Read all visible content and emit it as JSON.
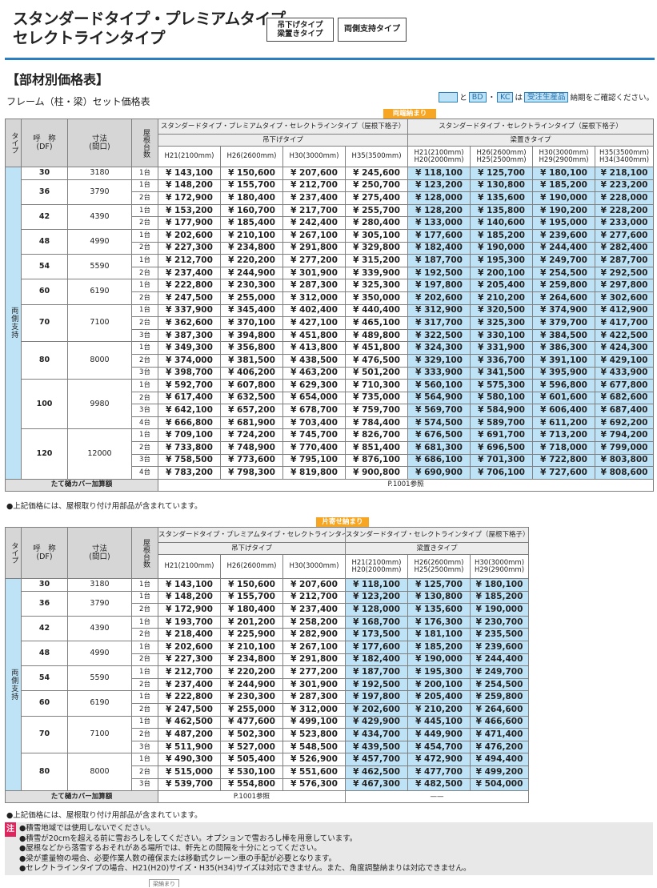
{
  "header": {
    "title_line1": "スタンダードタイプ・プレミアムタイプ",
    "title_line2": "セレクトラインタイプ",
    "tag1_line1": "吊下げタイプ",
    "tag1_line2": "梁置きタイプ",
    "tag2": "両側支持タイプ"
  },
  "section_title": "【部材別価格表】",
  "subtitle": "フレーム（柱・梁）セット価格表",
  "note_top": {
    "and": "と",
    "bd": "BD",
    "dot": "・",
    "kc": "KC",
    "on": "は",
    "order": "受注生産品",
    "suffix": "納期をご確認ください。"
  },
  "table1": {
    "badge": "両端納まり",
    "col_type": "タイプ",
    "col_name_l1": "呼　称",
    "col_name_l2": "(DF)",
    "col_size_l1": "寸法",
    "col_size_l2": "(間口)",
    "col_count": "屋根台数",
    "group_left": "スタンダードタイプ・プレミアムタイプ・セレクトラインタイプ（屋根下格子）",
    "group_right": "スタンダードタイプ・セレクトラインタイプ（屋根下格子）",
    "sub_left": "吊下げタイプ",
    "sub_right": "梁置きタイプ",
    "heights": [
      "H21(2100mm)",
      "H26(2600mm)",
      "H30(3000mm)",
      "H35(3500mm)"
    ],
    "heights2": [
      [
        "H21(2100mm)",
        "H20(2000mm)"
      ],
      [
        "H26(2600mm)",
        "H25(2500mm)"
      ],
      [
        "H30(3000mm)",
        "H29(2900mm)"
      ],
      [
        "H35(3500mm)",
        "H34(3400mm)"
      ]
    ],
    "type_label": "両側支持",
    "groups": [
      {
        "name": "30",
        "size": "3180",
        "rows": [
          [
            "1台",
            "¥ 143,100",
            "¥ 150,600",
            "¥ 207,600",
            "¥ 245,600",
            "¥ 118,100",
            "¥ 125,700",
            "¥ 180,100",
            "¥ 218,100"
          ]
        ]
      },
      {
        "name": "36",
        "size": "3790",
        "rows": [
          [
            "1台",
            "¥ 148,200",
            "¥ 155,700",
            "¥ 212,700",
            "¥ 250,700",
            "¥ 123,200",
            "¥ 130,800",
            "¥ 185,200",
            "¥ 223,200"
          ],
          [
            "2台",
            "¥ 172,900",
            "¥ 180,400",
            "¥ 237,400",
            "¥ 275,400",
            "¥ 128,000",
            "¥ 135,600",
            "¥ 190,000",
            "¥ 228,000"
          ]
        ]
      },
      {
        "name": "42",
        "size": "4390",
        "rows": [
          [
            "1台",
            "¥ 153,200",
            "¥ 160,700",
            "¥ 217,700",
            "¥ 255,700",
            "¥ 128,200",
            "¥ 135,800",
            "¥ 190,200",
            "¥ 228,200"
          ],
          [
            "2台",
            "¥ 177,900",
            "¥ 185,400",
            "¥ 242,400",
            "¥ 280,400",
            "¥ 133,000",
            "¥ 140,600",
            "¥ 195,000",
            "¥ 233,000"
          ]
        ]
      },
      {
        "name": "48",
        "size": "4990",
        "rows": [
          [
            "1台",
            "¥ 202,600",
            "¥ 210,100",
            "¥ 267,100",
            "¥ 305,100",
            "¥ 177,600",
            "¥ 185,200",
            "¥ 239,600",
            "¥ 277,600"
          ],
          [
            "2台",
            "¥ 227,300",
            "¥ 234,800",
            "¥ 291,800",
            "¥ 329,800",
            "¥ 182,400",
            "¥ 190,000",
            "¥ 244,400",
            "¥ 282,400"
          ]
        ]
      },
      {
        "name": "54",
        "size": "5590",
        "rows": [
          [
            "1台",
            "¥ 212,700",
            "¥ 220,200",
            "¥ 277,200",
            "¥ 315,200",
            "¥ 187,700",
            "¥ 195,300",
            "¥ 249,700",
            "¥ 287,700"
          ],
          [
            "2台",
            "¥ 237,400",
            "¥ 244,900",
            "¥ 301,900",
            "¥ 339,900",
            "¥ 192,500",
            "¥ 200,100",
            "¥ 254,500",
            "¥ 292,500"
          ]
        ]
      },
      {
        "name": "60",
        "size": "6190",
        "rows": [
          [
            "1台",
            "¥ 222,800",
            "¥ 230,300",
            "¥ 287,300",
            "¥ 325,300",
            "¥ 197,800",
            "¥ 205,400",
            "¥ 259,800",
            "¥ 297,800"
          ],
          [
            "2台",
            "¥ 247,500",
            "¥ 255,000",
            "¥ 312,000",
            "¥ 350,000",
            "¥ 202,600",
            "¥ 210,200",
            "¥ 264,600",
            "¥ 302,600"
          ]
        ]
      },
      {
        "name": "70",
        "size": "7100",
        "rows": [
          [
            "1台",
            "¥ 337,900",
            "¥ 345,400",
            "¥ 402,400",
            "¥ 440,400",
            "¥ 312,900",
            "¥ 320,500",
            "¥ 374,900",
            "¥ 412,900"
          ],
          [
            "2台",
            "¥ 362,600",
            "¥ 370,100",
            "¥ 427,100",
            "¥ 465,100",
            "¥ 317,700",
            "¥ 325,300",
            "¥ 379,700",
            "¥ 417,700"
          ],
          [
            "3台",
            "¥ 387,300",
            "¥ 394,800",
            "¥ 451,800",
            "¥ 489,800",
            "¥ 322,500",
            "¥ 330,100",
            "¥ 384,500",
            "¥ 422,500"
          ]
        ]
      },
      {
        "name": "80",
        "size": "8000",
        "rows": [
          [
            "1台",
            "¥ 349,300",
            "¥ 356,800",
            "¥ 413,800",
            "¥ 451,800",
            "¥ 324,300",
            "¥ 331,900",
            "¥ 386,300",
            "¥ 424,300"
          ],
          [
            "2台",
            "¥ 374,000",
            "¥ 381,500",
            "¥ 438,500",
            "¥ 476,500",
            "¥ 329,100",
            "¥ 336,700",
            "¥ 391,100",
            "¥ 429,100"
          ],
          [
            "3台",
            "¥ 398,700",
            "¥ 406,200",
            "¥ 463,200",
            "¥ 501,200",
            "¥ 333,900",
            "¥ 341,500",
            "¥ 395,900",
            "¥ 433,900"
          ]
        ]
      },
      {
        "name": "100",
        "size": "9980",
        "rows": [
          [
            "1台",
            "¥ 592,700",
            "¥ 607,800",
            "¥ 629,300",
            "¥ 710,300",
            "¥ 560,100",
            "¥ 575,300",
            "¥ 596,800",
            "¥ 677,800"
          ],
          [
            "2台",
            "¥ 617,400",
            "¥ 632,500",
            "¥ 654,000",
            "¥ 735,000",
            "¥ 564,900",
            "¥ 580,100",
            "¥ 601,600",
            "¥ 682,600"
          ],
          [
            "3台",
            "¥ 642,100",
            "¥ 657,200",
            "¥ 678,700",
            "¥ 759,700",
            "¥ 569,700",
            "¥ 584,900",
            "¥ 606,400",
            "¥ 687,400"
          ],
          [
            "4台",
            "¥ 666,800",
            "¥ 681,900",
            "¥ 703,400",
            "¥ 784,400",
            "¥ 574,500",
            "¥ 589,700",
            "¥ 611,200",
            "¥ 692,200"
          ]
        ]
      },
      {
        "name": "120",
        "size": "12000",
        "rows": [
          [
            "1台",
            "¥ 709,100",
            "¥ 724,200",
            "¥ 745,700",
            "¥ 826,700",
            "¥ 676,500",
            "¥ 691,700",
            "¥ 713,200",
            "¥ 794,200"
          ],
          [
            "2台",
            "¥ 733,800",
            "¥ 748,900",
            "¥ 770,400",
            "¥ 851,400",
            "¥ 681,300",
            "¥ 696,500",
            "¥ 718,000",
            "¥ 799,000"
          ],
          [
            "3台",
            "¥ 758,500",
            "¥ 773,600",
            "¥ 795,100",
            "¥ 876,100",
            "¥ 686,100",
            "¥ 701,300",
            "¥ 722,800",
            "¥ 803,800"
          ],
          [
            "4台",
            "¥ 783,200",
            "¥ 798,300",
            "¥ 819,800",
            "¥ 900,800",
            "¥ 690,900",
            "¥ 706,100",
            "¥ 727,600",
            "¥ 808,600"
          ]
        ]
      }
    ],
    "bottom_label": "たて樋カバー加算額",
    "bottom_value": "P.1001参照",
    "footnote": "●上記価格には、屋根取り付け用部品が含まれています。"
  },
  "table2": {
    "badge": "片寄せ納まり",
    "col_type": "タイプ",
    "col_name_l1": "呼　称",
    "col_name_l2": "(DF)",
    "col_size_l1": "寸法",
    "col_size_l2": "(間口)",
    "col_count": "屋根台数",
    "group_left": "スタンダードタイプ・プレミアムタイプ・セレクトラインタイプ（屋根下格子）",
    "group_right": "スタンダードタイプ・セレクトラインタイプ（屋根下格子）",
    "sub_left": "吊下げタイプ",
    "sub_right": "梁置きタイプ",
    "heights": [
      "H21(2100mm)",
      "H26(2600mm)",
      "H30(3000mm)"
    ],
    "heights2": [
      [
        "H21(2100mm)",
        "H20(2000mm)"
      ],
      [
        "H26(2600mm)",
        "H25(2500mm)"
      ],
      [
        "H30(3000mm)",
        "H29(2900mm)"
      ]
    ],
    "type_label": "両側支持",
    "groups": [
      {
        "name": "30",
        "size": "3180",
        "rows": [
          [
            "1台",
            "¥ 143,100",
            "¥ 150,600",
            "¥ 207,600",
            "¥ 118,100",
            "¥ 125,700",
            "¥ 180,100"
          ]
        ]
      },
      {
        "name": "36",
        "size": "3790",
        "rows": [
          [
            "1台",
            "¥ 148,200",
            "¥ 155,700",
            "¥ 212,700",
            "¥ 123,200",
            "¥ 130,800",
            "¥ 185,200"
          ],
          [
            "2台",
            "¥ 172,900",
            "¥ 180,400",
            "¥ 237,400",
            "¥ 128,000",
            "¥ 135,600",
            "¥ 190,000"
          ]
        ]
      },
      {
        "name": "42",
        "size": "4390",
        "rows": [
          [
            "1台",
            "¥ 193,700",
            "¥ 201,200",
            "¥ 258,200",
            "¥ 168,700",
            "¥ 176,300",
            "¥ 230,700"
          ],
          [
            "2台",
            "¥ 218,400",
            "¥ 225,900",
            "¥ 282,900",
            "¥ 173,500",
            "¥ 181,100",
            "¥ 235,500"
          ]
        ]
      },
      {
        "name": "48",
        "size": "4990",
        "rows": [
          [
            "1台",
            "¥ 202,600",
            "¥ 210,100",
            "¥ 267,100",
            "¥ 177,600",
            "¥ 185,200",
            "¥ 239,600"
          ],
          [
            "2台",
            "¥ 227,300",
            "¥ 234,800",
            "¥ 291,800",
            "¥ 182,400",
            "¥ 190,000",
            "¥ 244,400"
          ]
        ]
      },
      {
        "name": "54",
        "size": "5590",
        "rows": [
          [
            "1台",
            "¥ 212,700",
            "¥ 220,200",
            "¥ 277,200",
            "¥ 187,700",
            "¥ 195,300",
            "¥ 249,700"
          ],
          [
            "2台",
            "¥ 237,400",
            "¥ 244,900",
            "¥ 301,900",
            "¥ 192,500",
            "¥ 200,100",
            "¥ 254,500"
          ]
        ]
      },
      {
        "name": "60",
        "size": "6190",
        "rows": [
          [
            "1台",
            "¥ 222,800",
            "¥ 230,300",
            "¥ 287,300",
            "¥ 197,800",
            "¥ 205,400",
            "¥ 259,800"
          ],
          [
            "2台",
            "¥ 247,500",
            "¥ 255,000",
            "¥ 312,000",
            "¥ 202,600",
            "¥ 210,200",
            "¥ 264,600"
          ]
        ]
      },
      {
        "name": "70",
        "size": "7100",
        "rows": [
          [
            "1台",
            "¥ 462,500",
            "¥ 477,600",
            "¥ 499,100",
            "¥ 429,900",
            "¥ 445,100",
            "¥ 466,600"
          ],
          [
            "2台",
            "¥ 487,200",
            "¥ 502,300",
            "¥ 523,800",
            "¥ 434,700",
            "¥ 449,900",
            "¥ 471,400"
          ],
          [
            "3台",
            "¥ 511,900",
            "¥ 527,000",
            "¥ 548,500",
            "¥ 439,500",
            "¥ 454,700",
            "¥ 476,200"
          ]
        ]
      },
      {
        "name": "80",
        "size": "8000",
        "rows": [
          [
            "1台",
            "¥ 490,300",
            "¥ 505,400",
            "¥ 526,900",
            "¥ 457,700",
            "¥ 472,900",
            "¥ 494,400"
          ],
          [
            "2台",
            "¥ 515,000",
            "¥ 530,100",
            "¥ 551,600",
            "¥ 462,500",
            "¥ 477,700",
            "¥ 499,200"
          ],
          [
            "3台",
            "¥ 539,700",
            "¥ 554,800",
            "¥ 576,300",
            "¥ 467,300",
            "¥ 482,500",
            "¥ 504,000"
          ]
        ]
      }
    ],
    "bottom_label": "たて樋カバー加算額",
    "bottom_value": "P.1001参照",
    "bottom_value2": "——",
    "footnote": "●上記価格には、屋根取り付け用部品が含まれています。"
  },
  "caution": {
    "label": "注",
    "items": [
      "●積雪地域では使用しないでください。",
      "●積雪が20cmを超える前に雪おろしをしてください。オプションで雪おろし棒を用意しています。",
      "●屋根などから落雪するおそれがある場所では、軒先との間隔を十分にとってください。",
      "●梁が重量物の場合、必要作業人数の確保または移動式クレーン車の手配が必要となります。",
      "●セレクトラインタイプの場合、H21(H20)サイズ・H35(H34)サイズは対応できません。また、角度調整納まりは対応できません。"
    ]
  },
  "tail_label": "梁納まり"
}
